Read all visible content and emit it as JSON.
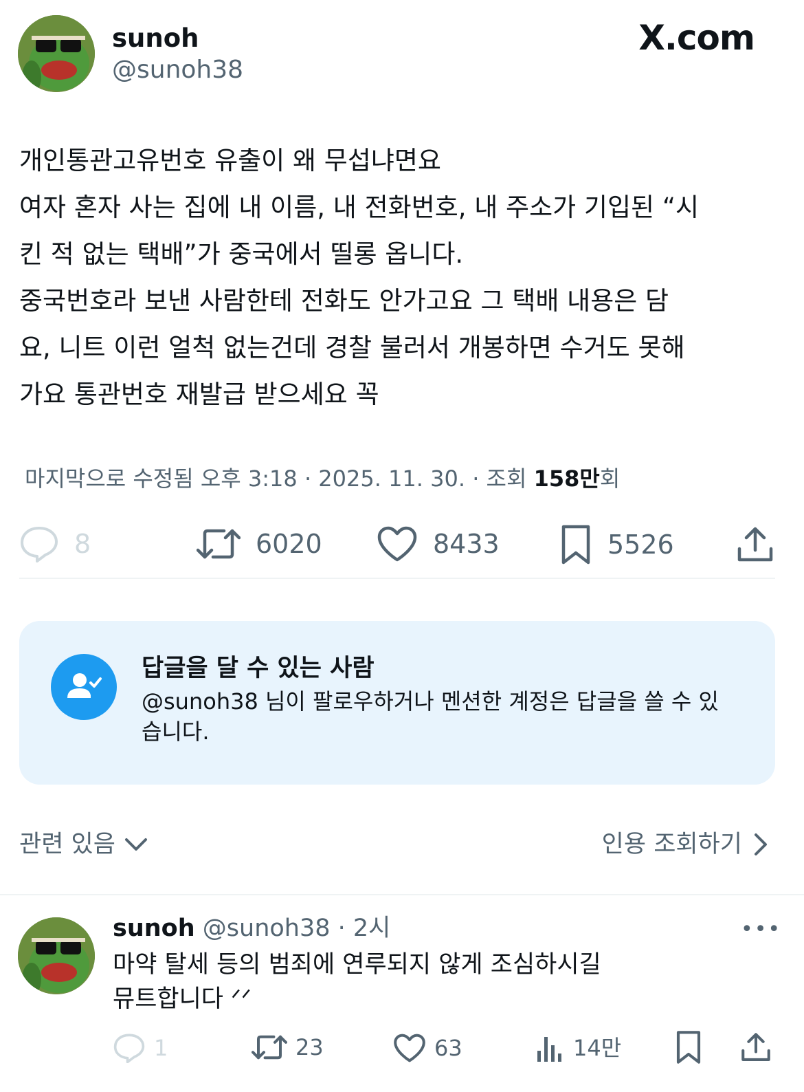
{
  "post": {
    "author_name": "sunoh",
    "author_handle": "@sunoh38",
    "site_logo": "X.com",
    "text_lines": [
      "개인통관고유번호 유출이 왜 무섭냐면요",
      "여자 혼자 사는 집에 내 이름, 내 전화번호, 내 주소가 기입된 “시",
      "킨 적 없는 택배”가 중국에서 띨롱 옵니다.",
      "중국번호라 보낸 사람한테 전화도 안가고요 그 택배 내용은 담",
      "요, 니트 이런 얼척 없는건데 경찰 불러서 개봉하면 수거도 못해",
      "가요 통관번호 재발급 받으세요 꼭"
    ],
    "meta_edited": "마지막으로 수정됨 오후 3:18 · 2025. 11. 30.",
    "meta_views_prefix": " · 조회 ",
    "meta_views_value": "158만",
    "meta_views_suffix": "회",
    "actions": {
      "replies": "8",
      "reposts": "6020",
      "likes": "8433",
      "bookmarks": "5526"
    },
    "icons": [
      "reply-icon",
      "repost-icon",
      "like-icon",
      "bookmark-icon",
      "share-icon"
    ]
  },
  "reply_restriction": {
    "title": "답글을 달 수 있는 사람",
    "description": "@sunoh38 님이 팔로우하거나 멘션한 계정은 답글을 쓸 수 있습니다.",
    "icon": "person-check-icon"
  },
  "filters": {
    "related_label": "관련 있음",
    "quotes_label": "인용 조회하기"
  },
  "reply": {
    "author_name": "sunoh",
    "author_handle": "@sunoh38",
    "time": "· 2시",
    "line1": "마약 탈세 등의 범죄에 연루되지 않게 조심하시길",
    "line2": "뮤트합니다 ᐟᐟ",
    "actions": {
      "replies": "1",
      "reposts": "23",
      "likes": "63",
      "views": "14만"
    }
  },
  "colors": {
    "text": "#0f1419",
    "muted": "#536471",
    "accent": "#1d9bf0",
    "card_bg": "#e8f4fd",
    "divider": "#eff3f4"
  }
}
